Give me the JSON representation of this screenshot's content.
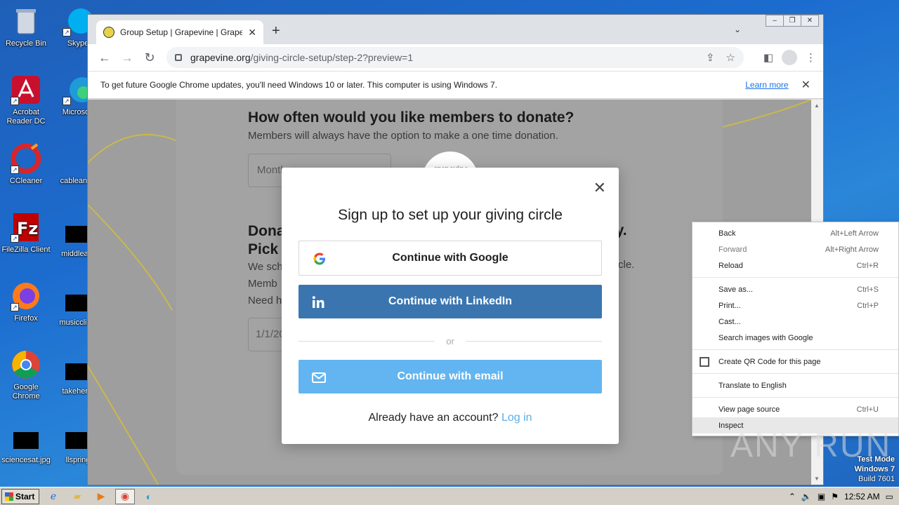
{
  "desktop": {
    "icons_left": [
      {
        "label": "Recycle Bin",
        "icon": "recycle-bin-icon"
      },
      {
        "label": "Acrobat Reader DC",
        "icon": "acrobat-icon"
      },
      {
        "label": "CCleaner",
        "icon": "ccleaner-icon"
      },
      {
        "label": "FileZilla Client",
        "icon": "filezilla-icon"
      },
      {
        "label": "Firefox",
        "icon": "firefox-icon"
      },
      {
        "label": "Google Chrome",
        "icon": "chrome-icon"
      },
      {
        "label": "sciencesat.jpg",
        "icon": "image-file-icon"
      }
    ],
    "icons_right": [
      {
        "label": "Skype",
        "icon": "skype-icon"
      },
      {
        "label": "Microsoft",
        "icon": "edge-icon"
      },
      {
        "label": "cableannu",
        "icon": "file-icon"
      },
      {
        "label": "middleam",
        "icon": "file-icon"
      },
      {
        "label": "musicclinic",
        "icon": "file-icon"
      },
      {
        "label": "takeher...",
        "icon": "file-icon"
      },
      {
        "label": "llspring",
        "icon": "file-icon"
      }
    ],
    "watermark": "ANY RUN",
    "test_mode": {
      "line1": "Test Mode",
      "line2": "Windows 7",
      "line3": "Build 7601"
    }
  },
  "browser": {
    "tab_title": "Group Setup | Grapevine | Grapevine",
    "url_domain": "grapevine.org",
    "url_path": "/giving-circle-setup/step-2?preview=1",
    "infobar": {
      "message": "To get future Google Chrome updates, you'll need Windows 10 or later. This computer is using Windows 7.",
      "link": "Learn more"
    }
  },
  "page": {
    "q1_title": "How often would you like members to donate?",
    "q1_sub": "Members will always have the option to make a one time donation.",
    "select_value": "Month",
    "q2_line1": "Dona",
    "q2_line2": "Pick",
    "q2_right": "ay.",
    "body_lines": [
      "We sch",
      "Memb",
      "Need h"
    ],
    "body_right": "cycle.",
    "date_value": "1/1/20",
    "logo_text": "grapevine"
  },
  "modal": {
    "title": "Sign up to set up your giving circle",
    "google": "Continue with Google",
    "linkedin": "Continue with LinkedIn",
    "or": "or",
    "email": "Continue with email",
    "account_prompt": "Already have an account?",
    "login": "Log in"
  },
  "context_menu": {
    "items": [
      {
        "label": "Back",
        "shortcut": "Alt+Left Arrow"
      },
      {
        "label": "Forward",
        "shortcut": "Alt+Right Arrow"
      },
      {
        "label": "Reload",
        "shortcut": "Ctrl+R"
      },
      {
        "label": "Save as...",
        "shortcut": "Ctrl+S"
      },
      {
        "label": "Print...",
        "shortcut": "Ctrl+P"
      },
      {
        "label": "Cast...",
        "shortcut": ""
      },
      {
        "label": "Search images with Google",
        "shortcut": ""
      },
      {
        "label": "Create QR Code for this page",
        "shortcut": ""
      },
      {
        "label": "Translate to English",
        "shortcut": ""
      },
      {
        "label": "View page source",
        "shortcut": "Ctrl+U"
      },
      {
        "label": "Inspect",
        "shortcut": ""
      }
    ]
  },
  "taskbar": {
    "start": "Start",
    "clock": "12:52 AM"
  },
  "colors": {
    "linkedin": "#3a75b0",
    "email": "#62b5f0",
    "link": "#1a73e8"
  }
}
